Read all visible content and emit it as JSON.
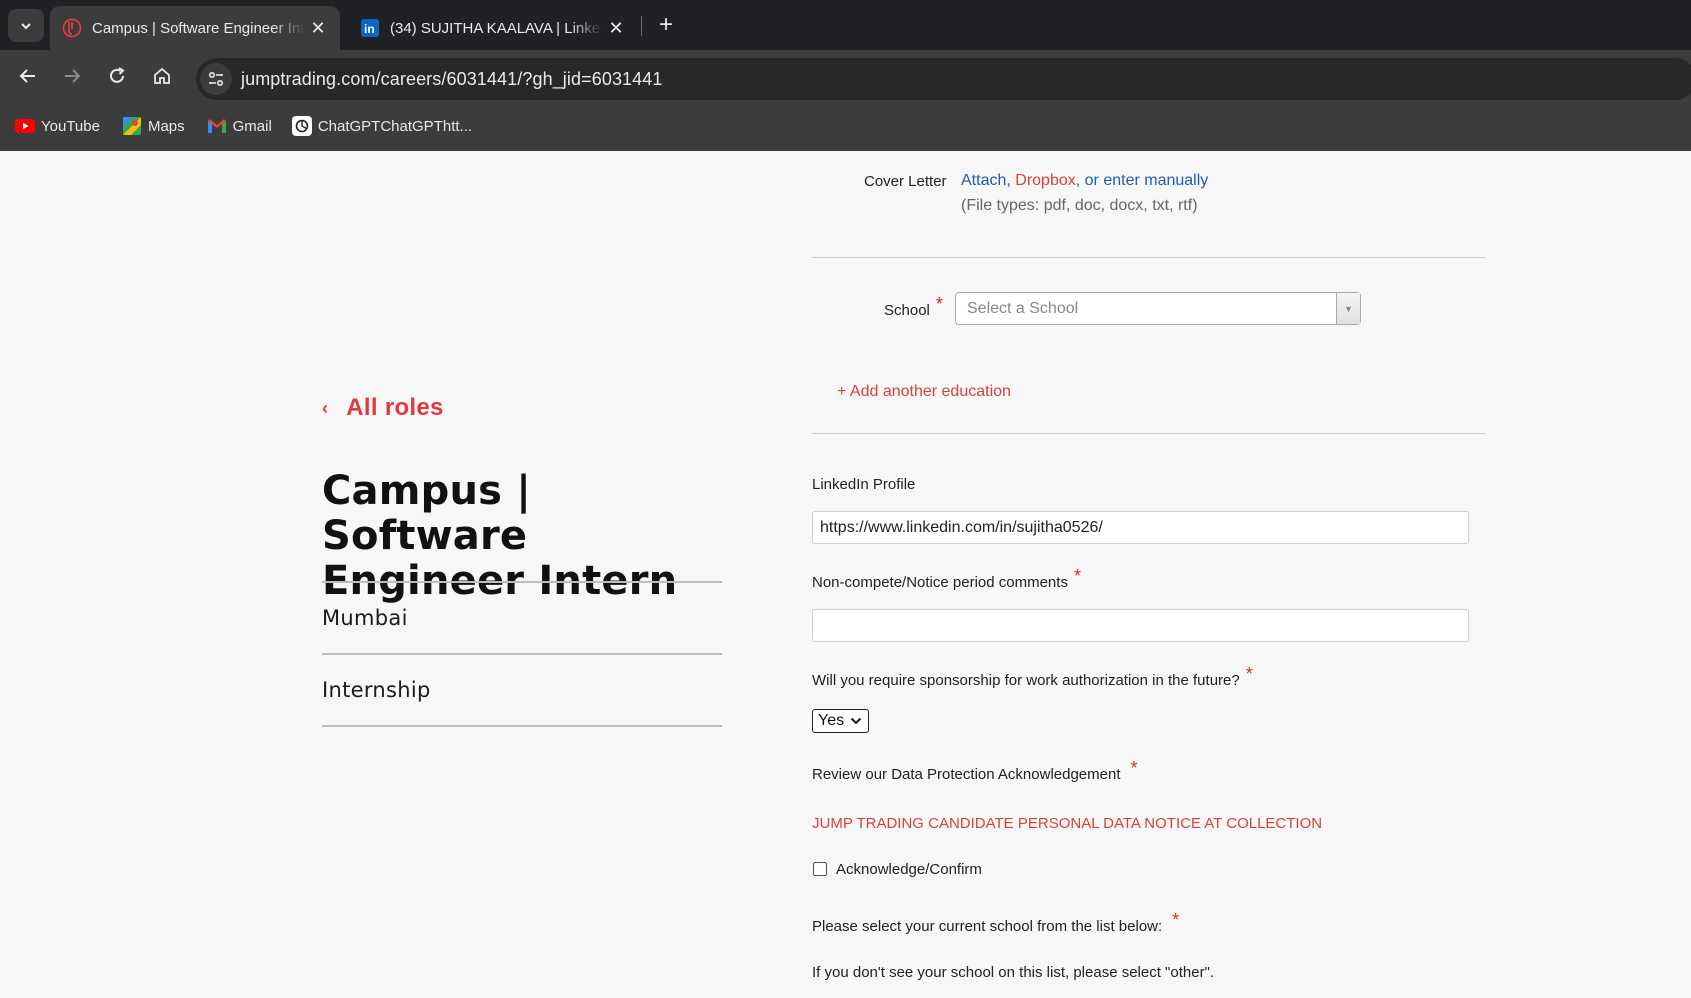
{
  "browser": {
    "tabs": [
      {
        "title": "Campus | Software Engineer Intern",
        "active": true,
        "favicon": "jump-trading-icon"
      },
      {
        "title": "(34) SUJITHA KAALAVA | LinkedIn",
        "active": false,
        "favicon": "linkedin-icon"
      }
    ],
    "url": "jumptrading.com/careers/6031441/?gh_jid=6031441",
    "bookmarks": [
      {
        "label": "YouTube",
        "icon": "youtube-icon"
      },
      {
        "label": "Maps",
        "icon": "maps-icon"
      },
      {
        "label": "Gmail",
        "icon": "gmail-icon"
      },
      {
        "label": "ChatGPTChatGPThtt...",
        "icon": "chatgpt-icon"
      }
    ]
  },
  "job": {
    "back_label": "All roles",
    "title": "Campus | Software Engineer Intern",
    "location": "Mumbai",
    "type": "Internship"
  },
  "form": {
    "cover_letter": {
      "label": "Cover Letter",
      "attach": "Attach",
      "comma1": ",",
      "dropbox": "Dropbox",
      "comma2": ",",
      "manual": "or enter manually",
      "file_types": "(File types: pdf, doc, docx, txt, rtf)"
    },
    "school": {
      "label": "School",
      "required": "*",
      "placeholder": "Select a School"
    },
    "add_education": "+ Add another education",
    "linkedin": {
      "label": "LinkedIn Profile",
      "value": "https://www.linkedin.com/in/sujitha0526/"
    },
    "noncompete": {
      "label": "Non-compete/Notice period comments",
      "required": "*",
      "value": ""
    },
    "sponsorship": {
      "label": "Will you require sponsorship for work authorization in the future?",
      "required": "*",
      "value": "Yes"
    },
    "data_protection": {
      "label": "Review our Data Protection Acknowledgement",
      "required": "*",
      "link": "JUMP TRADING CANDIDATE PERSONAL DATA NOTICE AT COLLECTION",
      "checkbox_label": "Acknowledge/Confirm",
      "checked": false
    },
    "current_school": {
      "label": "Please select your current school from the list below:",
      "required": "*",
      "hint": "If you don't see your school on this list, please select \"other\"."
    }
  },
  "colors": {
    "brand_red": "#e03a3e",
    "link_blue": "#1f5ea8",
    "chrome_dark": "#202124",
    "chrome_toolbar": "#3c3c3c"
  }
}
